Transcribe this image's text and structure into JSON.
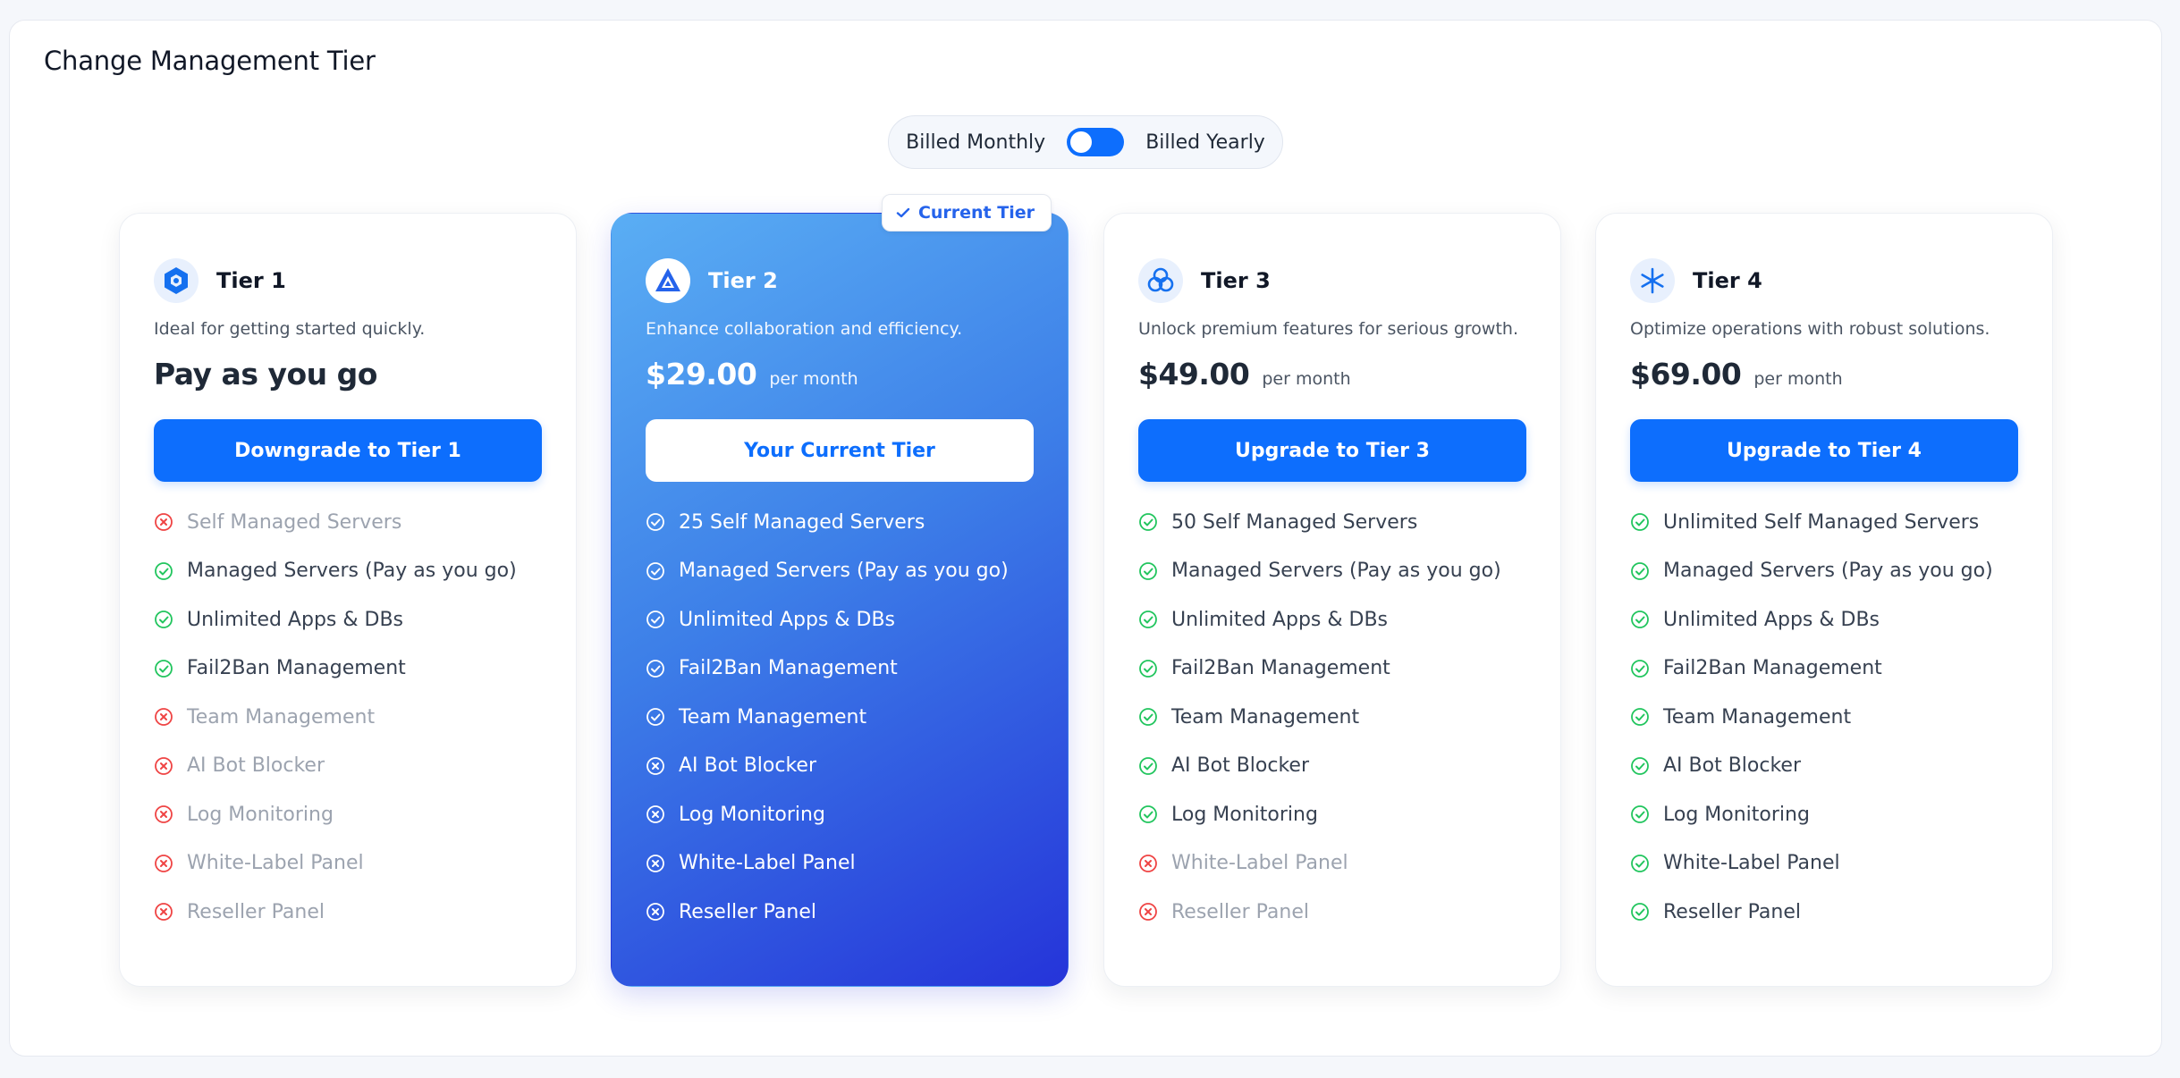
{
  "page": {
    "title": "Change Management Tier"
  },
  "billing": {
    "monthly_label": "Billed Monthly",
    "yearly_label": "Billed Yearly"
  },
  "colors": {
    "accent": "#0d6efd",
    "check": "#22c55e",
    "cross": "#ef4444"
  },
  "tiers": [
    {
      "name": "Tier 1",
      "icon": "hexagon-icon",
      "description": "Ideal for getting started quickly.",
      "price": "Pay as you go",
      "period": "",
      "button": "Downgrade to Tier 1",
      "current": false,
      "features": [
        {
          "label": "Self Managed Servers",
          "included": false
        },
        {
          "label": "Managed Servers (Pay as you go)",
          "included": true
        },
        {
          "label": "Unlimited Apps & DBs",
          "included": true
        },
        {
          "label": "Fail2Ban Management",
          "included": true
        },
        {
          "label": "Team Management",
          "included": false
        },
        {
          "label": "AI Bot Blocker",
          "included": false
        },
        {
          "label": "Log Monitoring",
          "included": false
        },
        {
          "label": "White-Label Panel",
          "included": false
        },
        {
          "label": "Reseller Panel",
          "included": false
        }
      ]
    },
    {
      "name": "Tier 2",
      "icon": "triangle-icon",
      "description": "Enhance collaboration and efficiency.",
      "price": "$29.00",
      "period": "per month",
      "button": "Your Current Tier",
      "current": true,
      "badge": "Current Tier",
      "features": [
        {
          "label": "25 Self Managed Servers",
          "included": true
        },
        {
          "label": "Managed Servers (Pay as you go)",
          "included": true
        },
        {
          "label": "Unlimited Apps & DBs",
          "included": true
        },
        {
          "label": "Fail2Ban Management",
          "included": true
        },
        {
          "label": "Team Management",
          "included": true
        },
        {
          "label": "AI Bot Blocker",
          "included": false
        },
        {
          "label": "Log Monitoring",
          "included": false
        },
        {
          "label": "White-Label Panel",
          "included": false
        },
        {
          "label": "Reseller Panel",
          "included": false
        }
      ]
    },
    {
      "name": "Tier 3",
      "icon": "knot-icon",
      "description": "Unlock premium features for serious growth.",
      "price": "$49.00",
      "period": "per month",
      "button": "Upgrade to Tier 3",
      "current": false,
      "features": [
        {
          "label": "50 Self Managed Servers",
          "included": true
        },
        {
          "label": "Managed Servers (Pay as you go)",
          "included": true
        },
        {
          "label": "Unlimited Apps & DBs",
          "included": true
        },
        {
          "label": "Fail2Ban Management",
          "included": true
        },
        {
          "label": "Team Management",
          "included": true
        },
        {
          "label": "AI Bot Blocker",
          "included": true
        },
        {
          "label": "Log Monitoring",
          "included": true
        },
        {
          "label": "White-Label Panel",
          "included": false
        },
        {
          "label": "Reseller Panel",
          "included": false
        }
      ]
    },
    {
      "name": "Tier 4",
      "icon": "snowflake-icon",
      "description": "Optimize operations with robust solutions.",
      "price": "$69.00",
      "period": "per month",
      "button": "Upgrade to Tier 4",
      "current": false,
      "features": [
        {
          "label": "Unlimited Self Managed Servers",
          "included": true
        },
        {
          "label": "Managed Servers (Pay as you go)",
          "included": true
        },
        {
          "label": "Unlimited Apps & DBs",
          "included": true
        },
        {
          "label": "Fail2Ban Management",
          "included": true
        },
        {
          "label": "Team Management",
          "included": true
        },
        {
          "label": "AI Bot Blocker",
          "included": true
        },
        {
          "label": "Log Monitoring",
          "included": true
        },
        {
          "label": "White-Label Panel",
          "included": true
        },
        {
          "label": "Reseller Panel",
          "included": true
        }
      ]
    }
  ]
}
